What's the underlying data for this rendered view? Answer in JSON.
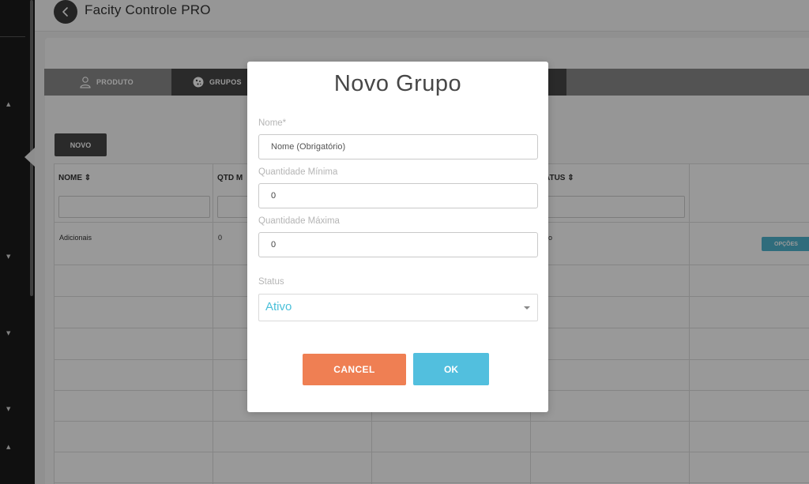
{
  "header": {
    "title": "Facity Controle PRO",
    "back_icon": "chevron-left-icon"
  },
  "tabs": [
    {
      "label": "PRODUTO",
      "icon": "user-icon"
    },
    {
      "label": "GRUPOS",
      "icon": "cookie-icon"
    }
  ],
  "toolbar": {
    "novo_label": "NOVO"
  },
  "table": {
    "columns": [
      "NOME ⇕",
      "QTD M",
      "ATUS ⇕"
    ],
    "rows": [
      {
        "nome": "Adicionais",
        "qtd": "0",
        "status": "o",
        "action": "OPÇÕES"
      }
    ]
  },
  "modal": {
    "title": "Novo Grupo",
    "fields": {
      "nome": {
        "label": "Nome*",
        "placeholder": "Nome (Obrigatório)"
      },
      "qtd_min": {
        "label": "Quantidade Mínima",
        "value": "0"
      },
      "qtd_max": {
        "label": "Quantidade Máxima",
        "value": "0"
      },
      "status": {
        "label": "Status",
        "value": "Ativo"
      }
    },
    "cancel_label": "CANCEL",
    "ok_label": "OK"
  },
  "colors": {
    "accent": "#52bfde",
    "cancel": "#ef7f53",
    "dark": "#474747"
  }
}
